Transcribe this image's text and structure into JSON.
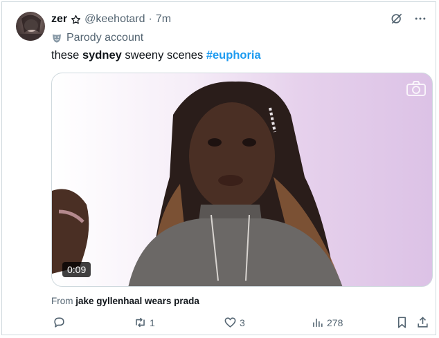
{
  "author": {
    "name": "zer",
    "handle": "@keehotard",
    "separator": "·",
    "time": "7m",
    "label": "Parody account"
  },
  "tweet": {
    "text_prefix": "these ",
    "text_bold": "sydney",
    "text_middle": " sweeny scenes ",
    "hashtag": "#euphoria"
  },
  "media": {
    "duration": "0:09"
  },
  "source": {
    "prefix": "From ",
    "name": "jake gyllenhaal wears prada"
  },
  "actions": {
    "reply_count": "",
    "retweet_count": "1",
    "like_count": "3",
    "views_count": "278"
  },
  "icons": {
    "star": "star-outline-icon",
    "mask": "parody-mask-icon",
    "grok": "grok-icon",
    "more": "more-dots-icon",
    "camera": "camera-icon",
    "reply": "reply-icon",
    "retweet": "retweet-icon",
    "like": "heart-icon",
    "views": "views-bar-icon",
    "bookmark": "bookmark-icon",
    "share": "share-icon"
  },
  "colors": {
    "link": "#1d9bf0",
    "secondary_text": "#536471",
    "primary_text": "#0f1419"
  }
}
